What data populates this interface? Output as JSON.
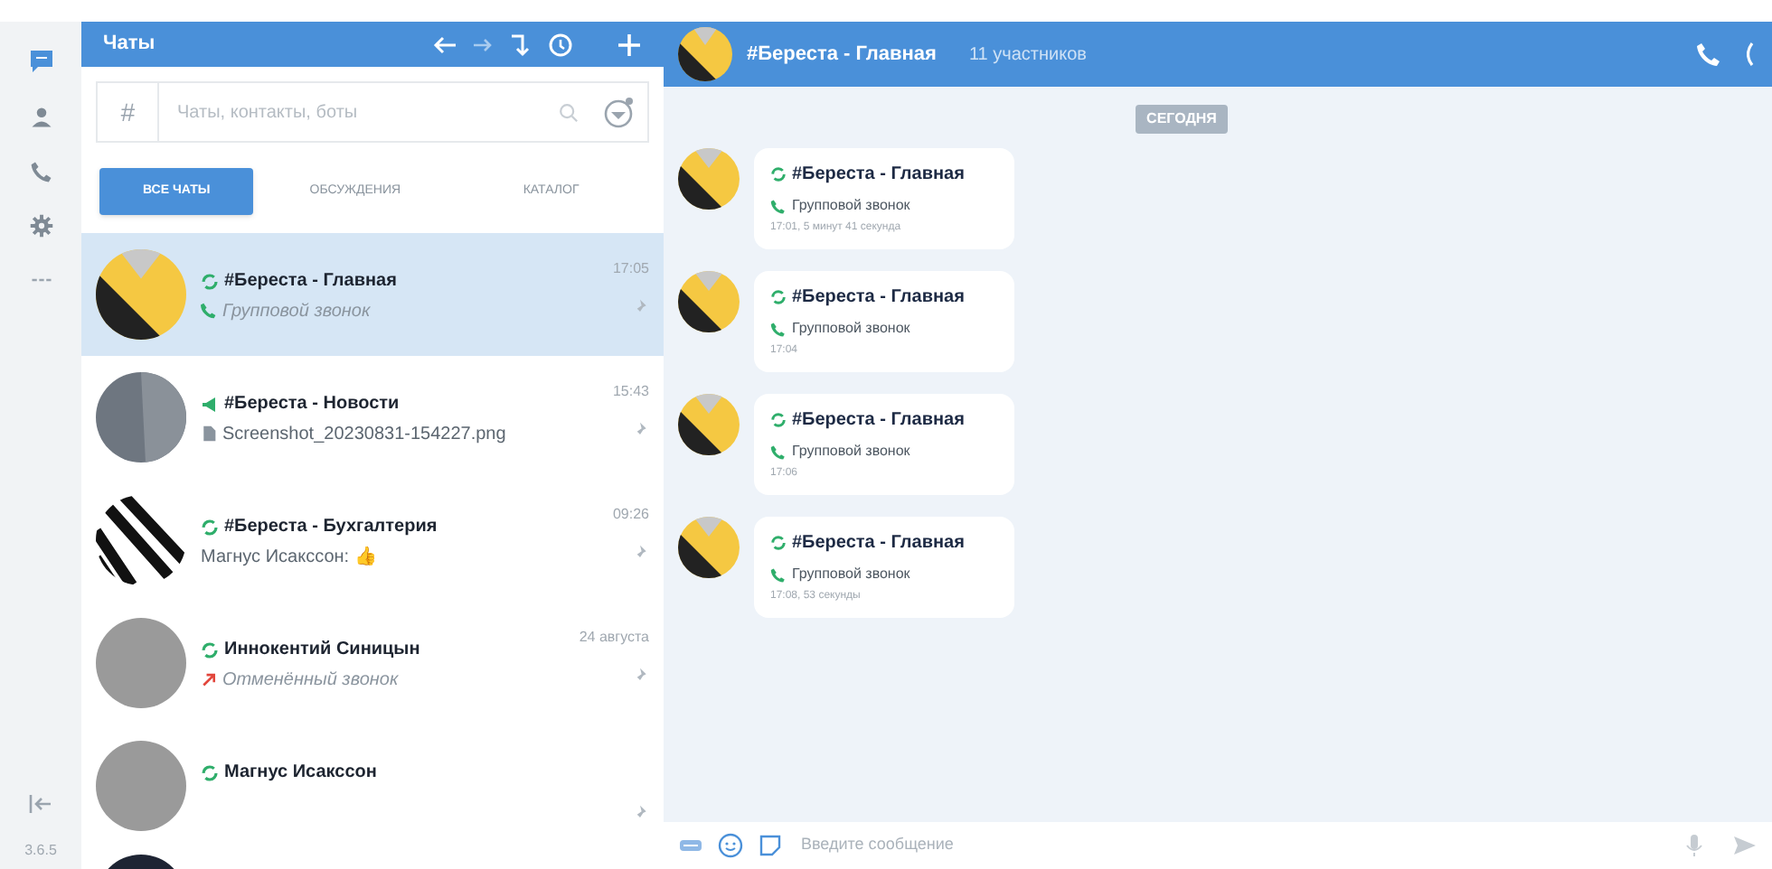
{
  "rail": {
    "items": [
      {
        "kind": "chats",
        "selected": true
      },
      {
        "kind": "contacts",
        "selected": false
      },
      {
        "kind": "calls",
        "selected": false
      },
      {
        "kind": "settings",
        "selected": false
      },
      {
        "kind": "more",
        "selected": false
      }
    ],
    "version": "3.6.5"
  },
  "list_header": {
    "title": "Чаты"
  },
  "search": {
    "prefix": "#",
    "placeholder": "Чаты, контакты, боты"
  },
  "tabs": [
    {
      "label": "ВСЕ ЧАТЫ",
      "selected": true
    },
    {
      "label": "ОБСУЖДЕНИЯ",
      "selected": false
    },
    {
      "label": "КАТАЛОГ",
      "selected": false
    }
  ],
  "chats": [
    {
      "name": "#Береста - Главная",
      "kind": "group",
      "avatar": {
        "kind": "logo"
      },
      "preview_icon": {
        "kind": "call"
      },
      "preview": "Групповой звонок",
      "time": "17:05",
      "selected": true
    },
    {
      "name": "#Береста - Новости",
      "kind": "channel",
      "avatar": {
        "kind": "gray"
      },
      "preview_icon": {
        "kind": "file"
      },
      "preview": "Screenshot_20230831-154227.png",
      "time": "15:43",
      "selected": false
    },
    {
      "name": "#Береста - Бухгалтерия",
      "kind": "group",
      "avatar": {
        "kind": "stripes"
      },
      "preview": "Магнус Исакссон: 👍",
      "time": "09:26",
      "selected": false
    },
    {
      "name": "Иннокентий Синицын",
      "kind": "group",
      "avatar": {
        "kind": "photo"
      },
      "preview_icon": {
        "kind": "missed_call"
      },
      "preview": "Отменённый звонок",
      "time": "24 августа",
      "selected": false
    },
    {
      "name": "Магнус Исакссон",
      "kind": "group",
      "avatar": {
        "kind": "photo"
      },
      "selected": false
    },
    {
      "kind": "partial",
      "avatar": {
        "kind": "dark"
      },
      "selected": false
    }
  ],
  "conversation": {
    "title": "#Береста - Главная",
    "members": "11 участников",
    "date_label": "СЕГОДНЯ",
    "messages": [
      {
        "sender": "#Береста - Главная",
        "text": "Групповой звонок",
        "meta": "17:01, 5 минут 41 секунда"
      },
      {
        "sender": "#Береста - Главная",
        "text": "Групповой звонок",
        "meta": "17:04"
      },
      {
        "sender": "#Береста - Главная",
        "text": "Групповой звонок",
        "meta": "17:06"
      },
      {
        "sender": "#Береста - Главная",
        "text": "Групповой звонок",
        "meta": "17:08, 53 секунды"
      }
    ],
    "input": {
      "placeholder": "Введите сообщение"
    }
  }
}
